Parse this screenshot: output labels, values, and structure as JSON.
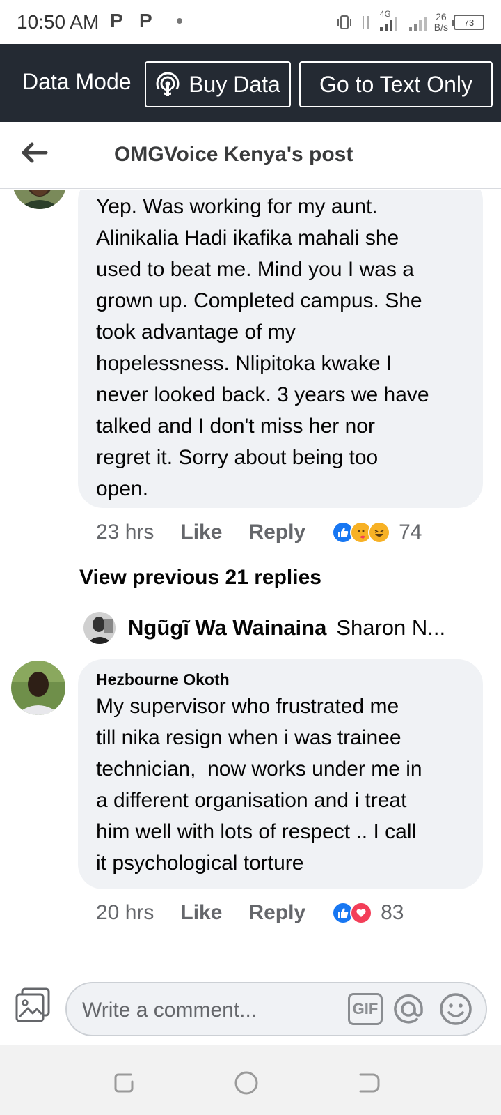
{
  "status_bar": {
    "time": "10:50 AM",
    "notification_1": "P",
    "notification_2": "P",
    "network": "4G",
    "speed_value": "26",
    "speed_unit": "B/s",
    "battery": "73"
  },
  "data_bar": {
    "mode_label": "Data Mode",
    "buy_label": "Buy Data",
    "text_only_label": "Go to Text Only"
  },
  "header": {
    "title": "OMGVoice Kenya's post"
  },
  "comments": [
    {
      "text": "Yep. Was working for my aunt.\nAlinikalia Hadi ikafika mahali she\nused to beat me. Mind you I was a\ngrown up. Completed campus. She\ntook advantage of my\nhopelessness. Nlipitoka kwake I\nnever looked back. 3 years we have\ntalked and I don't miss her nor\nregret it. Sorry about being too\nopen.",
      "time": "23 hrs",
      "like_label": "Like",
      "reply_label": "Reply",
      "reaction_count": "74"
    },
    {
      "author": "Hezbourne Okoth",
      "text": "My supervisor who frustrated me\ntill nika resign when i was trainee\ntechnician,  now works under me in\na different organisation and i treat\nhim well with lots of respect .. I call\nit psychological torture",
      "time": "20 hrs",
      "like_label": "Like",
      "reply_label": "Reply",
      "reaction_count": "83"
    }
  ],
  "view_previous": "View previous 21 replies",
  "reply_preview": {
    "author": "Ngũgĩ Wa Wainaina",
    "snippet": "Sharon N..."
  },
  "composer": {
    "placeholder": "Write a comment...",
    "gif_label": "GIF"
  },
  "colors": {
    "data_bar_bg": "#242a33",
    "bubble_bg": "#f0f2f5",
    "like_blue": "#1877f2",
    "love_red": "#f33e58",
    "haha_yellow": "#f7b125"
  }
}
